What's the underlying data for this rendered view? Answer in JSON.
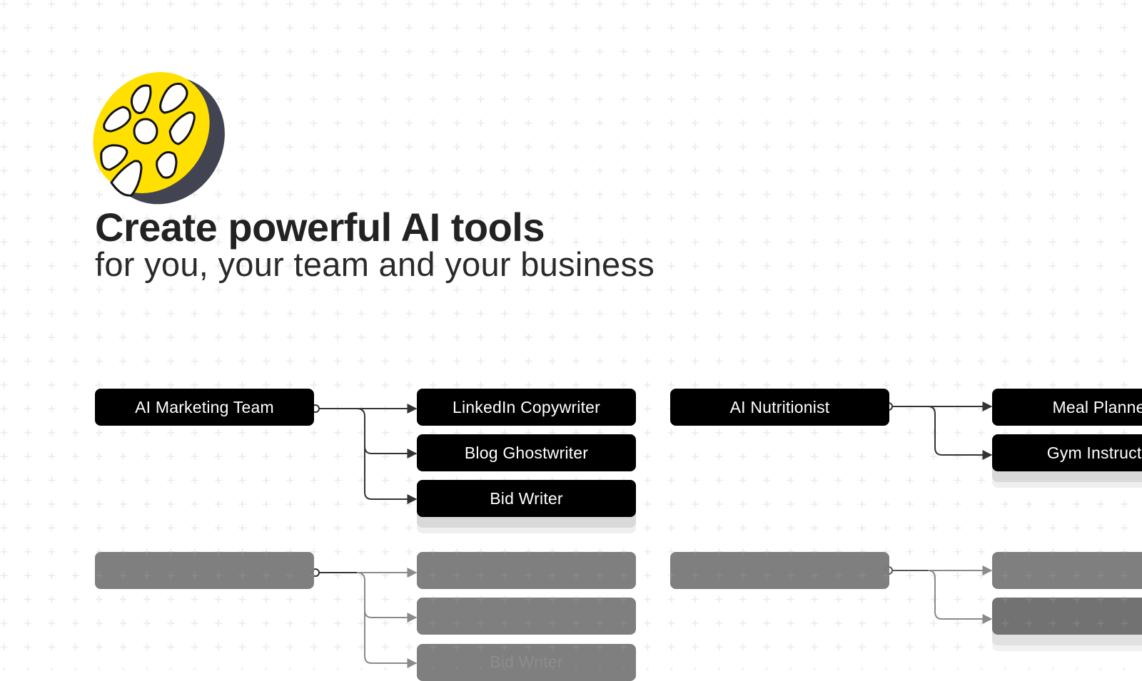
{
  "hero": {
    "logo_icon": "yellow-wheel-logo-icon",
    "title": "Create powerful AI tools",
    "subtitle": "for you, your team and your business"
  },
  "colors": {
    "logo_yellow": "#FFE000",
    "logo_shadow": "#424452",
    "node_bg": "#000000",
    "node_text": "#FFFFFF",
    "connector": "#333333",
    "faded_node_bg": "#7B7B7B",
    "grid_cross": "#EBEBEB"
  },
  "flows": [
    {
      "source": "AI Marketing Team",
      "targets": [
        "LinkedIn Copywriter",
        "Blog Ghostwriter",
        "Bid Writer"
      ]
    },
    {
      "source": "AI Nutritionist",
      "targets": [
        "Meal Planner",
        "Gym Instructor"
      ]
    }
  ],
  "faded_flows": [
    {
      "source": "",
      "targets": [
        "",
        "",
        "Bid Writer"
      ]
    },
    {
      "source": "",
      "targets": [
        "",
        ""
      ]
    }
  ]
}
